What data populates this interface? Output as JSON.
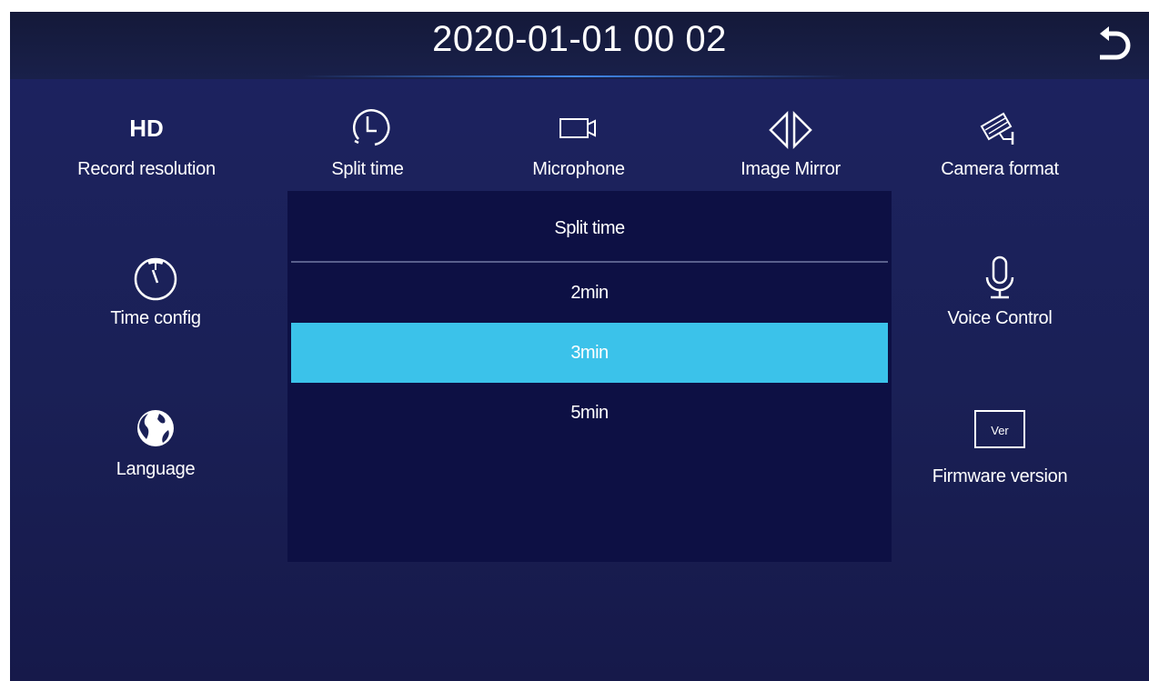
{
  "header": {
    "datetime": "2020-01-01  00 02"
  },
  "menu": {
    "items": [
      {
        "label": "Record resolution",
        "icon": "hd-icon",
        "icon_text": "HD"
      },
      {
        "label": "Split time",
        "icon": "clock-split-icon"
      },
      {
        "label": "Microphone",
        "icon": "camera-icon"
      },
      {
        "label": "Image Mirror",
        "icon": "mirror-icon"
      },
      {
        "label": "Camera format",
        "icon": "cctv-camera-icon"
      },
      {
        "label": "Time config",
        "icon": "clock-icon"
      },
      {
        "label": "Voice Control",
        "icon": "microphone-icon"
      },
      {
        "label": "Language",
        "icon": "globe-icon"
      },
      {
        "label": "Firmware version",
        "icon": "version-icon",
        "icon_text": "Ver"
      }
    ]
  },
  "dialog": {
    "title": "Split time",
    "options": [
      "2min",
      "3min",
      "5min"
    ],
    "selected": "3min"
  },
  "colors": {
    "selected": "#3bc2ea",
    "dialog_bg": "#0d1044",
    "screen_bg": "#1d2361"
  }
}
